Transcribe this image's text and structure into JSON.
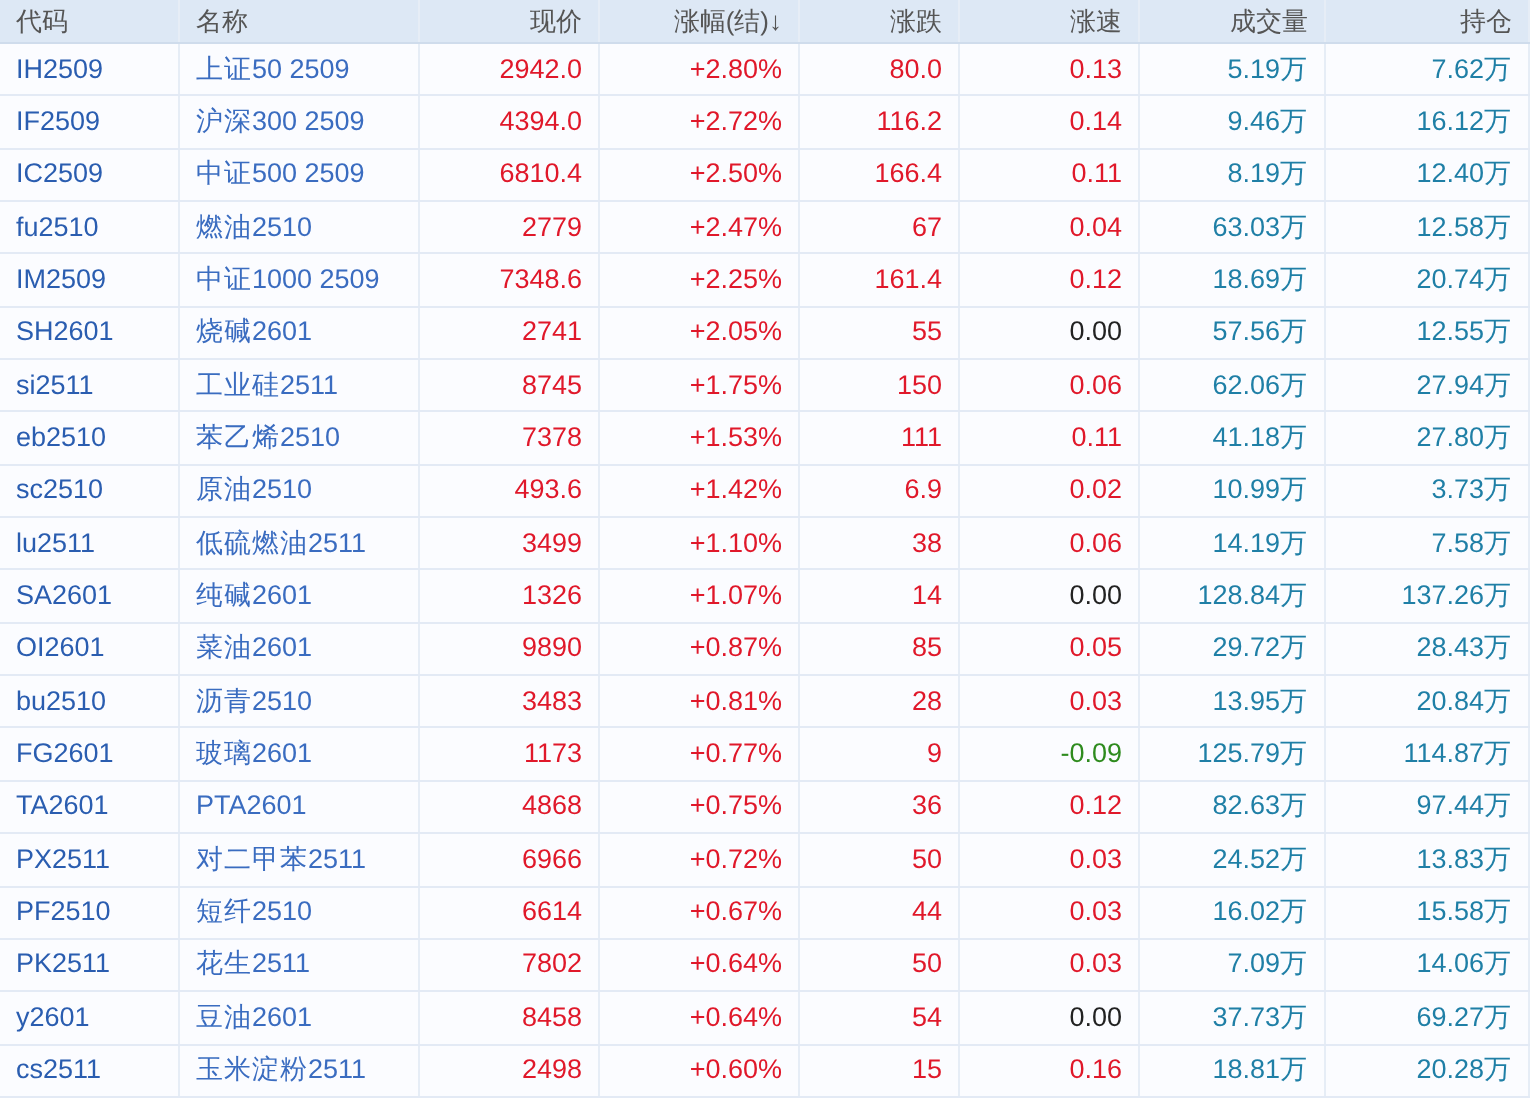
{
  "table": {
    "columns": [
      "代码",
      "名称",
      "现价",
      "涨幅(结)↓",
      "涨跌",
      "涨速",
      "成交量",
      "持仓"
    ],
    "rows": [
      {
        "code": "IH2509",
        "name": "上证50 2509",
        "price": "2942.0",
        "pct": "+2.80%",
        "change": "80.0",
        "speed": {
          "text": "0.13",
          "color": "#e0182a"
        },
        "color": "#e0182a",
        "volume": "5.19万",
        "oi": "7.62万"
      },
      {
        "code": "IF2509",
        "name": "沪深300 2509",
        "price": "4394.0",
        "pct": "+2.72%",
        "change": "116.2",
        "speed": {
          "text": "0.14",
          "color": "#e0182a"
        },
        "color": "#e0182a",
        "volume": "9.46万",
        "oi": "16.12万"
      },
      {
        "code": "IC2509",
        "name": "中证500 2509",
        "price": "6810.4",
        "pct": "+2.50%",
        "change": "166.4",
        "speed": {
          "text": "0.11",
          "color": "#e0182a"
        },
        "color": "#e0182a",
        "volume": "8.19万",
        "oi": "12.40万"
      },
      {
        "code": "fu2510",
        "name": "燃油2510",
        "price": "2779",
        "pct": "+2.47%",
        "change": "67",
        "speed": {
          "text": "0.04",
          "color": "#e0182a"
        },
        "color": "#e0182a",
        "volume": "63.03万",
        "oi": "12.58万"
      },
      {
        "code": "IM2509",
        "name": "中证1000 2509",
        "price": "7348.6",
        "pct": "+2.25%",
        "change": "161.4",
        "speed": {
          "text": "0.12",
          "color": "#e0182a"
        },
        "color": "#e0182a",
        "volume": "18.69万",
        "oi": "20.74万"
      },
      {
        "code": "SH2601",
        "name": "烧碱2601",
        "price": "2741",
        "pct": "+2.05%",
        "change": "55",
        "speed": {
          "text": "0.00",
          "color": "#222222"
        },
        "color": "#e0182a",
        "volume": "57.56万",
        "oi": "12.55万"
      },
      {
        "code": "si2511",
        "name": "工业硅2511",
        "price": "8745",
        "pct": "+1.75%",
        "change": "150",
        "speed": {
          "text": "0.06",
          "color": "#e0182a"
        },
        "color": "#e0182a",
        "volume": "62.06万",
        "oi": "27.94万"
      },
      {
        "code": "eb2510",
        "name": "苯乙烯2510",
        "price": "7378",
        "pct": "+1.53%",
        "change": "111",
        "speed": {
          "text": "0.11",
          "color": "#e0182a"
        },
        "color": "#e0182a",
        "volume": "41.18万",
        "oi": "27.80万"
      },
      {
        "code": "sc2510",
        "name": "原油2510",
        "price": "493.6",
        "pct": "+1.42%",
        "change": "6.9",
        "speed": {
          "text": "0.02",
          "color": "#e0182a"
        },
        "color": "#e0182a",
        "volume": "10.99万",
        "oi": "3.73万"
      },
      {
        "code": "lu2511",
        "name": "低硫燃油2511",
        "price": "3499",
        "pct": "+1.10%",
        "change": "38",
        "speed": {
          "text": "0.06",
          "color": "#e0182a"
        },
        "color": "#e0182a",
        "volume": "14.19万",
        "oi": "7.58万"
      },
      {
        "code": "SA2601",
        "name": "纯碱2601",
        "price": "1326",
        "pct": "+1.07%",
        "change": "14",
        "speed": {
          "text": "0.00",
          "color": "#222222"
        },
        "color": "#e0182a",
        "volume": "128.84万",
        "oi": "137.26万"
      },
      {
        "code": "OI2601",
        "name": "菜油2601",
        "price": "9890",
        "pct": "+0.87%",
        "change": "85",
        "speed": {
          "text": "0.05",
          "color": "#e0182a"
        },
        "color": "#e0182a",
        "volume": "29.72万",
        "oi": "28.43万"
      },
      {
        "code": "bu2510",
        "name": "沥青2510",
        "price": "3483",
        "pct": "+0.81%",
        "change": "28",
        "speed": {
          "text": "0.03",
          "color": "#e0182a"
        },
        "color": "#e0182a",
        "volume": "13.95万",
        "oi": "20.84万"
      },
      {
        "code": "FG2601",
        "name": "玻璃2601",
        "price": "1173",
        "pct": "+0.77%",
        "change": "9",
        "speed": {
          "text": "-0.09",
          "color": "#2e8b1e"
        },
        "color": "#e0182a",
        "volume": "125.79万",
        "oi": "114.87万"
      },
      {
        "code": "TA2601",
        "name": "PTA2601",
        "price": "4868",
        "pct": "+0.75%",
        "change": "36",
        "speed": {
          "text": "0.12",
          "color": "#e0182a"
        },
        "color": "#e0182a",
        "volume": "82.63万",
        "oi": "97.44万"
      },
      {
        "code": "PX2511",
        "name": "对二甲苯2511",
        "price": "6966",
        "pct": "+0.72%",
        "change": "50",
        "speed": {
          "text": "0.03",
          "color": "#e0182a"
        },
        "color": "#e0182a",
        "volume": "24.52万",
        "oi": "13.83万"
      },
      {
        "code": "PF2510",
        "name": "短纤2510",
        "price": "6614",
        "pct": "+0.67%",
        "change": "44",
        "speed": {
          "text": "0.03",
          "color": "#e0182a"
        },
        "color": "#e0182a",
        "volume": "16.02万",
        "oi": "15.58万"
      },
      {
        "code": "PK2511",
        "name": "花生2511",
        "price": "7802",
        "pct": "+0.64%",
        "change": "50",
        "speed": {
          "text": "0.03",
          "color": "#e0182a"
        },
        "color": "#e0182a",
        "volume": "7.09万",
        "oi": "14.06万"
      },
      {
        "code": "y2601",
        "name": "豆油2601",
        "price": "8458",
        "pct": "+0.64%",
        "change": "54",
        "speed": {
          "text": "0.00",
          "color": "#222222"
        },
        "color": "#e0182a",
        "volume": "37.73万",
        "oi": "69.27万"
      },
      {
        "code": "cs2511",
        "name": "玉米淀粉2511",
        "price": "2498",
        "pct": "+0.60%",
        "change": "15",
        "speed": {
          "text": "0.16",
          "color": "#e0182a"
        },
        "color": "#e0182a",
        "volume": "18.81万",
        "oi": "20.28万"
      }
    ]
  }
}
